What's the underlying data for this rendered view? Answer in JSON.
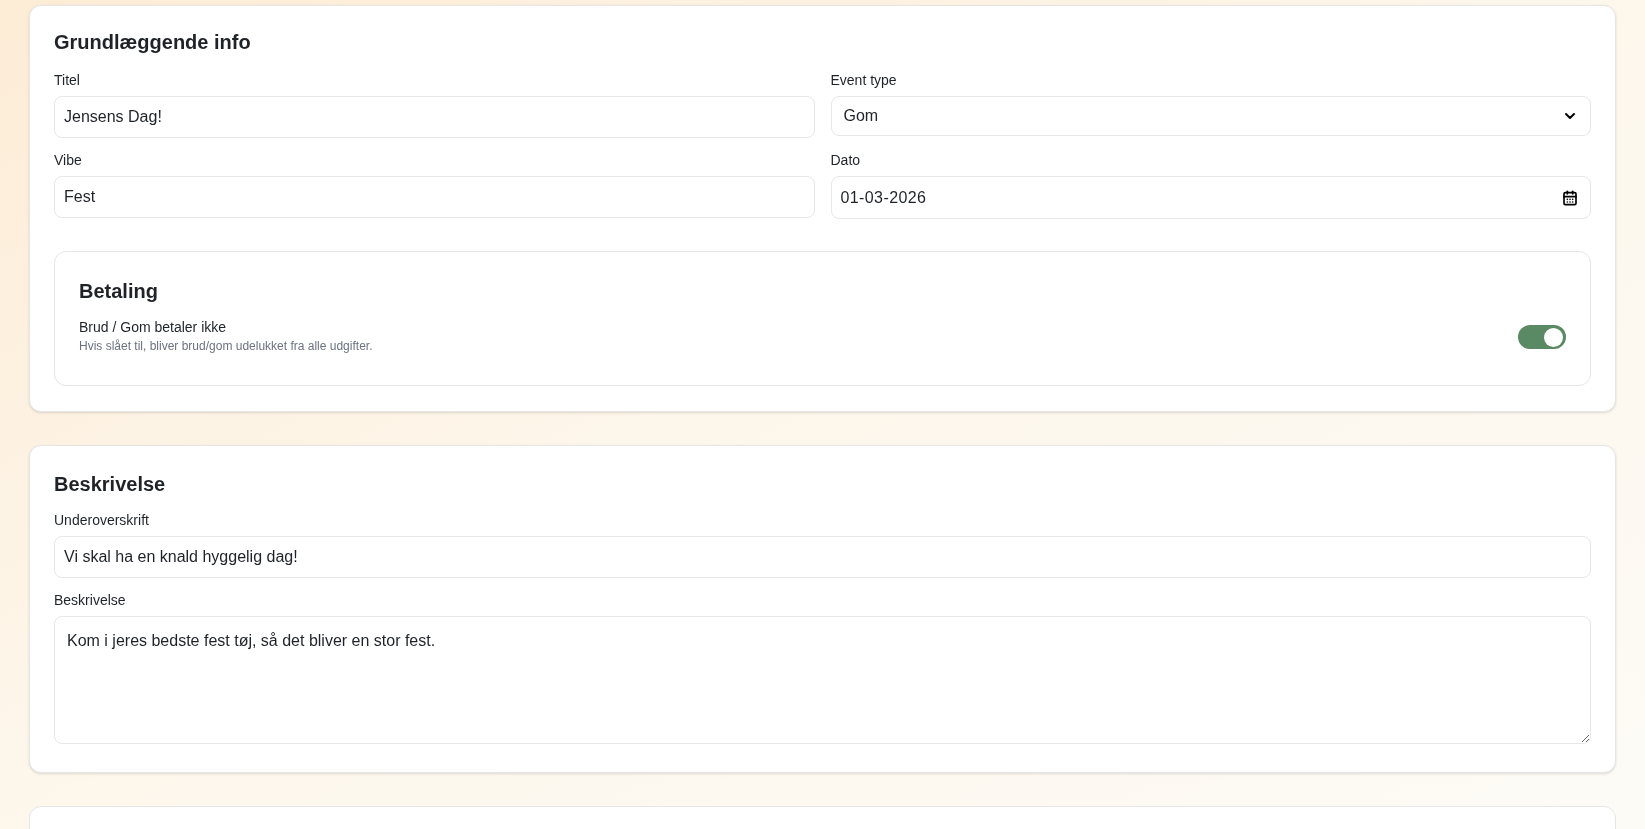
{
  "basic_info": {
    "heading": "Grundlæggende info",
    "fields": [
      {
        "kind": "text",
        "label": "Titel",
        "value": "Jensens Dag!"
      },
      {
        "kind": "select",
        "label": "Event type",
        "value": "Gom"
      },
      {
        "kind": "text",
        "label": "Vibe",
        "value": "Fest"
      },
      {
        "kind": "date",
        "label": "Dato",
        "value": "01-03-2026"
      }
    ],
    "payment": {
      "heading": "Betaling",
      "toggle_label": "Brud / Gom betaler ikke",
      "toggle_hint": "Hvis slået til, bliver brud/gom udelukket fra alle udgifter.",
      "on": true
    }
  },
  "description": {
    "heading": "Beskrivelse",
    "fields": [
      {
        "kind": "text",
        "label": "Underoverskrift",
        "value": "Vi skal ha en knald hyggelig dag!"
      },
      {
        "kind": "textarea",
        "label": "Beskrivelse",
        "value": "Kom i jeres bedste fest tøj, så det bliver en stor fest."
      }
    ]
  }
}
